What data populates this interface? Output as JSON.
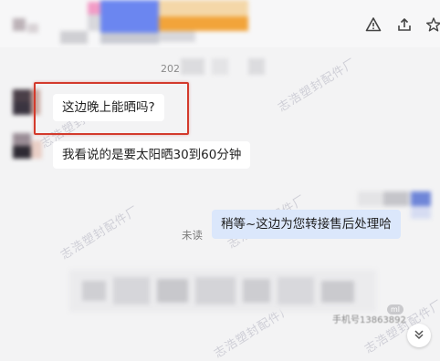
{
  "header": {
    "icons": [
      "warning-icon",
      "share-icon",
      "star-icon"
    ]
  },
  "timestamp": {
    "prefix": "202"
  },
  "messages": [
    {
      "sender": "other",
      "text": "这边晚上能晒吗?"
    },
    {
      "sender": "other",
      "text": "我看说的是要太阳晒30到60分钟"
    },
    {
      "sender": "me",
      "text": "稍等~这边为您转接售后处理哈",
      "status": "未读"
    }
  ],
  "footer": {
    "phone_text": "手机号13863892",
    "badge": "ml"
  },
  "watermark": {
    "text": "志浩塑封配件厂"
  },
  "colors": {
    "highlight_border": "#d33a2c",
    "my_bubble": "#dbe7fb",
    "other_bubble": "#ffffff"
  }
}
